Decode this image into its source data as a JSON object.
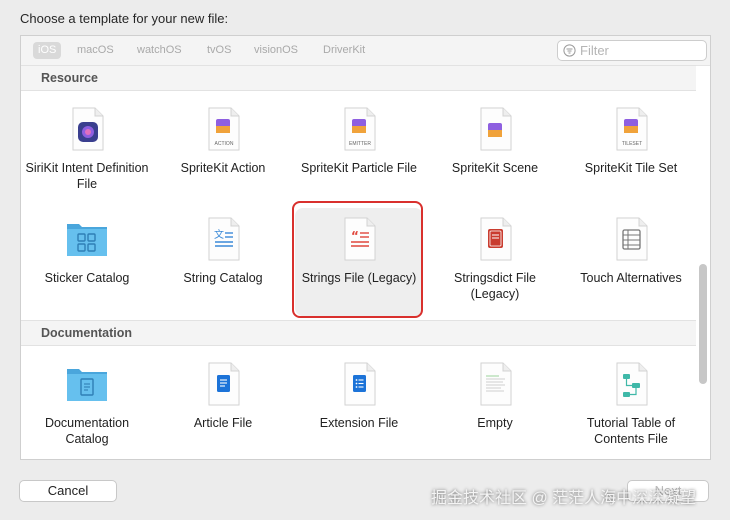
{
  "dialog": {
    "title": "Choose a template for your new file:"
  },
  "tabs": [
    "iOS",
    "macOS",
    "watchOS",
    "tvOS",
    "visionOS",
    "DriverKit"
  ],
  "filter": {
    "placeholder": "Filter"
  },
  "sections": [
    {
      "title": "Resource",
      "items": [
        {
          "label": "SiriKit Intent Definition File",
          "icon": "sirikit-intent-icon"
        },
        {
          "label": "SpriteKit Action",
          "icon": "spritekit-action-icon",
          "badge": "ACTION"
        },
        {
          "label": "SpriteKit Particle File",
          "icon": "spritekit-particle-icon",
          "badge": "EMITTER"
        },
        {
          "label": "SpriteKit Scene",
          "icon": "spritekit-scene-icon"
        },
        {
          "label": "SpriteKit Tile Set",
          "icon": "spritekit-tileset-icon",
          "badge": "TILESET"
        },
        {
          "label": "Sticker Catalog",
          "icon": "sticker-catalog-folder-icon"
        },
        {
          "label": "String Catalog",
          "icon": "string-catalog-icon"
        },
        {
          "label": "Strings File (Legacy)",
          "icon": "strings-file-icon",
          "selected": true
        },
        {
          "label": "Stringsdict File (Legacy)",
          "icon": "stringsdict-file-icon"
        },
        {
          "label": "Touch Alternatives",
          "icon": "touch-alternatives-icon"
        }
      ]
    },
    {
      "title": "Documentation",
      "items": [
        {
          "label": "Documentation Catalog",
          "icon": "documentation-catalog-folder-icon"
        },
        {
          "label": "Article File",
          "icon": "article-file-icon"
        },
        {
          "label": "Extension File",
          "icon": "extension-file-icon"
        },
        {
          "label": "Empty",
          "icon": "empty-file-icon"
        },
        {
          "label": "Tutorial Table of Contents File",
          "icon": "tutorial-toc-icon"
        }
      ]
    }
  ],
  "buttons": {
    "cancel": "Cancel",
    "next": "Next"
  },
  "watermark": "掘金技术社区 @ 茫茫人海中深深凝望",
  "colors": {
    "selection_outline": "#d9302d",
    "accent_purple": "#6a4fd0",
    "folder_blue": "#5cb8e8",
    "strings_red": "#e0463c"
  }
}
